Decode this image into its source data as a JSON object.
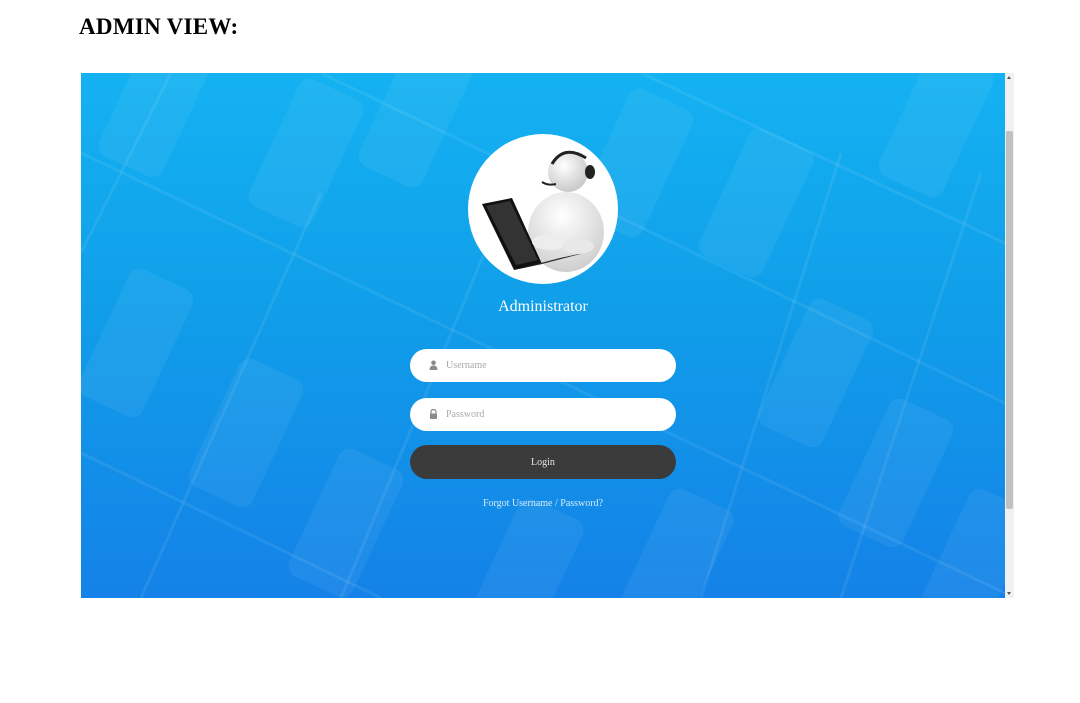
{
  "page": {
    "title": "ADMIN VIEW:"
  },
  "login": {
    "role_label": "Administrator",
    "username_placeholder": "Username",
    "password_placeholder": "Password",
    "login_button_label": "Login",
    "forgot_link_label": "Forgot Username / Password?"
  },
  "icons": {
    "avatar": "support-agent-laptop-icon",
    "username": "user-icon",
    "password": "lock-icon"
  },
  "colors": {
    "background_top": "#14b2f2",
    "background_bottom": "#1482e8",
    "login_button": "#3b3b3b",
    "field_background": "#ffffff"
  }
}
